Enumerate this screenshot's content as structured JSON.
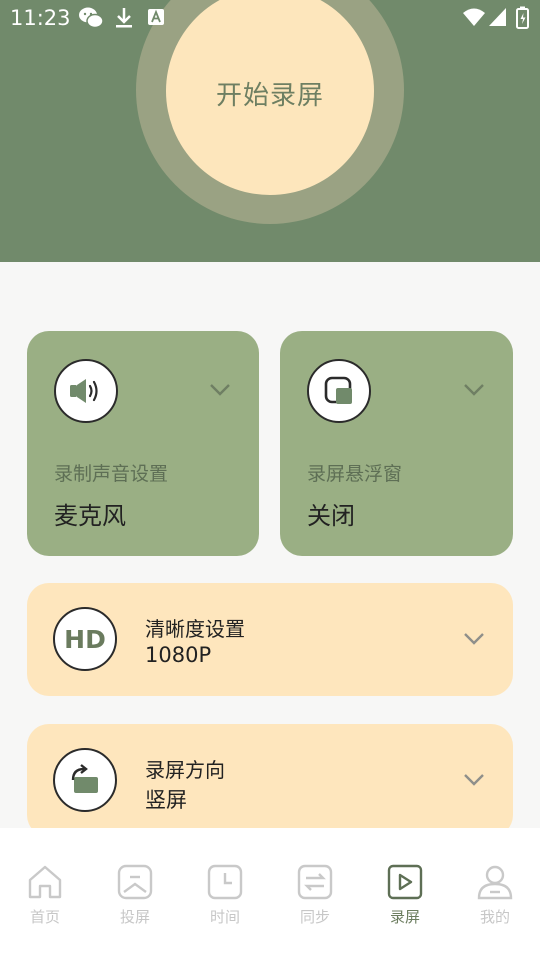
{
  "status_bar": {
    "time": "11:23"
  },
  "header": {
    "start_button_label": "开始录屏"
  },
  "audio_card": {
    "label": "录制声音设置",
    "value": "麦克风"
  },
  "float_card": {
    "label": "录屏悬浮窗",
    "value": "关闭"
  },
  "quality_row": {
    "title": "清晰度设置",
    "value": "1080P",
    "icon_text": "HD"
  },
  "orientation_row": {
    "title": "录屏方向",
    "value": "竖屏"
  },
  "tabs": [
    {
      "label": "首页",
      "icon": "home-icon"
    },
    {
      "label": "投屏",
      "icon": "cast-icon"
    },
    {
      "label": "时间",
      "icon": "clock-icon"
    },
    {
      "label": "同步",
      "icon": "sync-icon"
    },
    {
      "label": "录屏",
      "icon": "record-icon",
      "active": true
    },
    {
      "label": "我的",
      "icon": "profile-icon"
    }
  ],
  "colors": {
    "header_bg": "#718a6b",
    "accent_green": "#9aaf84",
    "cream": "#fee6bd",
    "active_tab": "#6c7d5f"
  }
}
